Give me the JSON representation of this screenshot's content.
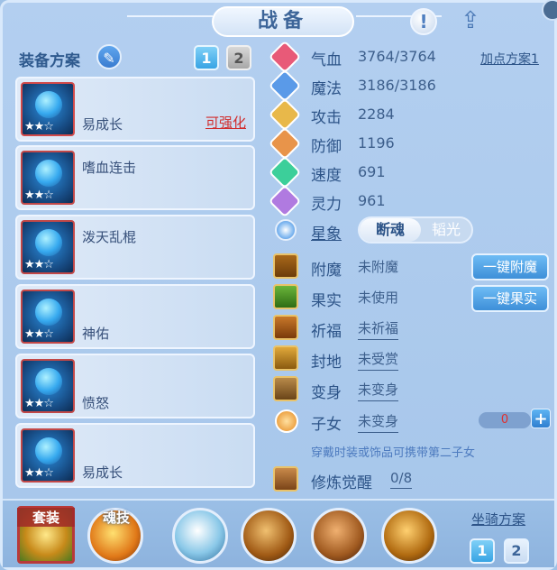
{
  "title": "战备",
  "colors": {
    "accent": "#38a4e4",
    "warning": "#d12c2c",
    "label": "#2d5488"
  },
  "icons": {
    "help": "exclamation-icon",
    "share": "share-icon"
  },
  "left": {
    "title": "装备方案",
    "tabs": [
      "1",
      "2"
    ],
    "items": [
      {
        "name": "易成长",
        "stars": "★★☆",
        "tag": "可强化"
      },
      {
        "name": "嗜血连击",
        "stars": "★★☆"
      },
      {
        "name": "泼天乱棍",
        "stars": "★★☆"
      },
      {
        "name": "神佑",
        "stars": "★★☆"
      },
      {
        "name": "愤怒",
        "stars": "★★☆"
      },
      {
        "name": "易成长",
        "stars": "★★☆"
      }
    ]
  },
  "stats": [
    {
      "label": "气血",
      "value": "3764/3764"
    },
    {
      "label": "魔法",
      "value": "3186/3186"
    },
    {
      "label": "攻击",
      "value": "2284"
    },
    {
      "label": "防御",
      "value": "1196"
    },
    {
      "label": "速度",
      "value": "691"
    },
    {
      "label": "灵力",
      "value": "961"
    }
  ],
  "add_points": "加点方案1",
  "xingxiang": {
    "label": "星象",
    "options": [
      "断魂",
      "韬光"
    ]
  },
  "rows": [
    {
      "label": "附魔",
      "value": "未附魔"
    },
    {
      "label": "果实",
      "value": "未使用"
    },
    {
      "label": "祈福",
      "value": "未祈福"
    },
    {
      "label": "封地",
      "value": "未受赏"
    },
    {
      "label": "变身",
      "value": "未变身"
    },
    {
      "label": "子女",
      "value": "未变身"
    }
  ],
  "buttons": {
    "enchant": "一键附魔",
    "fruit": "一键果实"
  },
  "child_count": "0",
  "hint": "穿戴时装或饰品可携带第二子女",
  "practice": {
    "label": "修炼觉醒",
    "value": "0/8"
  },
  "bottom": {
    "set": "套装",
    "soul": "魂技",
    "mount": "坐骑方案",
    "mount_tabs": [
      "1",
      "2"
    ]
  }
}
